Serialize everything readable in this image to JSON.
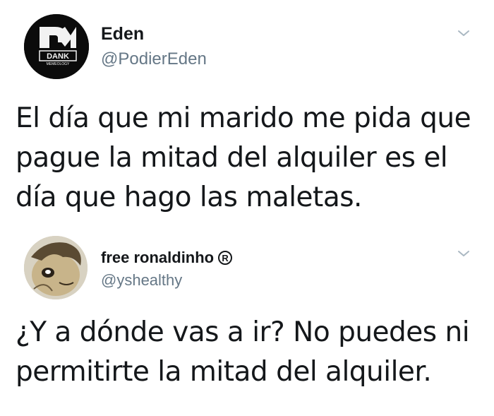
{
  "tweets": [
    {
      "display_name": "Eden",
      "handle": "@PodierEden",
      "avatar": {
        "logo_text": "DANK",
        "logo_subtext": "MEMEOLOGY",
        "icon": "dank-memeology-logo"
      },
      "text": "El día que mi marido me pida que pague la mitad del alquiler es el día que hago las maletas.",
      "menu_icon": "chevron-down-icon"
    },
    {
      "display_name": "free ronaldinho",
      "badge": "R",
      "handle": "@yshealthy",
      "avatar": {
        "icon": "anime-character-avatar"
      },
      "text": "¿Y a dónde vas a ir? No puedes ni permitirte la mitad del alquiler.",
      "menu_icon": "chevron-down-icon"
    }
  ],
  "colors": {
    "text": "#14171a",
    "secondary": "#657786",
    "chevron": "#aab8c2",
    "background": "#ffffff"
  }
}
